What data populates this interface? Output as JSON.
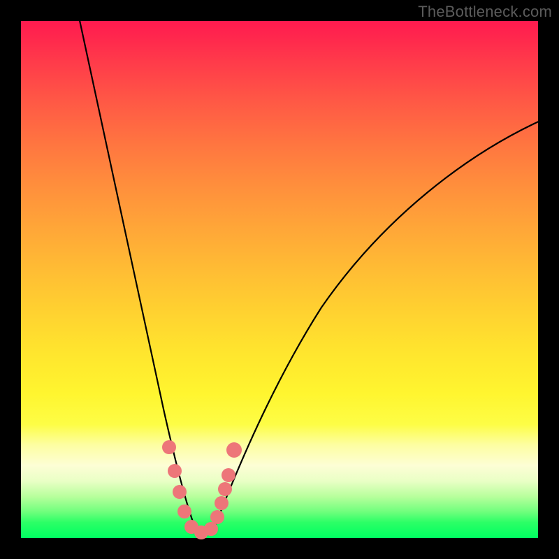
{
  "watermark": "TheBottleneck.com",
  "chart_data": {
    "type": "line",
    "title": "",
    "xlabel": "",
    "ylabel": "",
    "xlim": [
      0,
      100
    ],
    "ylim": [
      0,
      100
    ],
    "series": [
      {
        "name": "left-curve",
        "x": [
          12,
          14,
          16,
          18,
          20,
          22,
          24,
          26,
          28,
          30,
          32,
          33
        ],
        "y": [
          100,
          89,
          78,
          67,
          56,
          46,
          37,
          29,
          22,
          14,
          7,
          4
        ]
      },
      {
        "name": "right-curve",
        "x": [
          38,
          40,
          44,
          48,
          52,
          56,
          60,
          66,
          72,
          78,
          85,
          92,
          100
        ],
        "y": [
          4,
          8,
          16,
          24,
          31,
          38,
          44,
          52,
          59,
          65,
          71,
          76,
          81
        ]
      }
    ],
    "markers": {
      "name": "bottom-dots",
      "color": "#ed7679",
      "points": [
        {
          "x": 28.5,
          "y": 18
        },
        {
          "x": 29.6,
          "y": 13
        },
        {
          "x": 30.4,
          "y": 9
        },
        {
          "x": 31.2,
          "y": 4.5
        },
        {
          "x": 32.8,
          "y": 1.8
        },
        {
          "x": 34.8,
          "y": 1.2
        },
        {
          "x": 36.6,
          "y": 1.8
        },
        {
          "x": 37.8,
          "y": 4
        },
        {
          "x": 38.6,
          "y": 7
        },
        {
          "x": 39.2,
          "y": 10
        },
        {
          "x": 39.8,
          "y": 13
        },
        {
          "x": 41.0,
          "y": 18
        }
      ]
    },
    "gradient_stops": [
      {
        "pos": 0,
        "color": "#ff1a4f"
      },
      {
        "pos": 100,
        "color": "#00ff61"
      }
    ]
  }
}
